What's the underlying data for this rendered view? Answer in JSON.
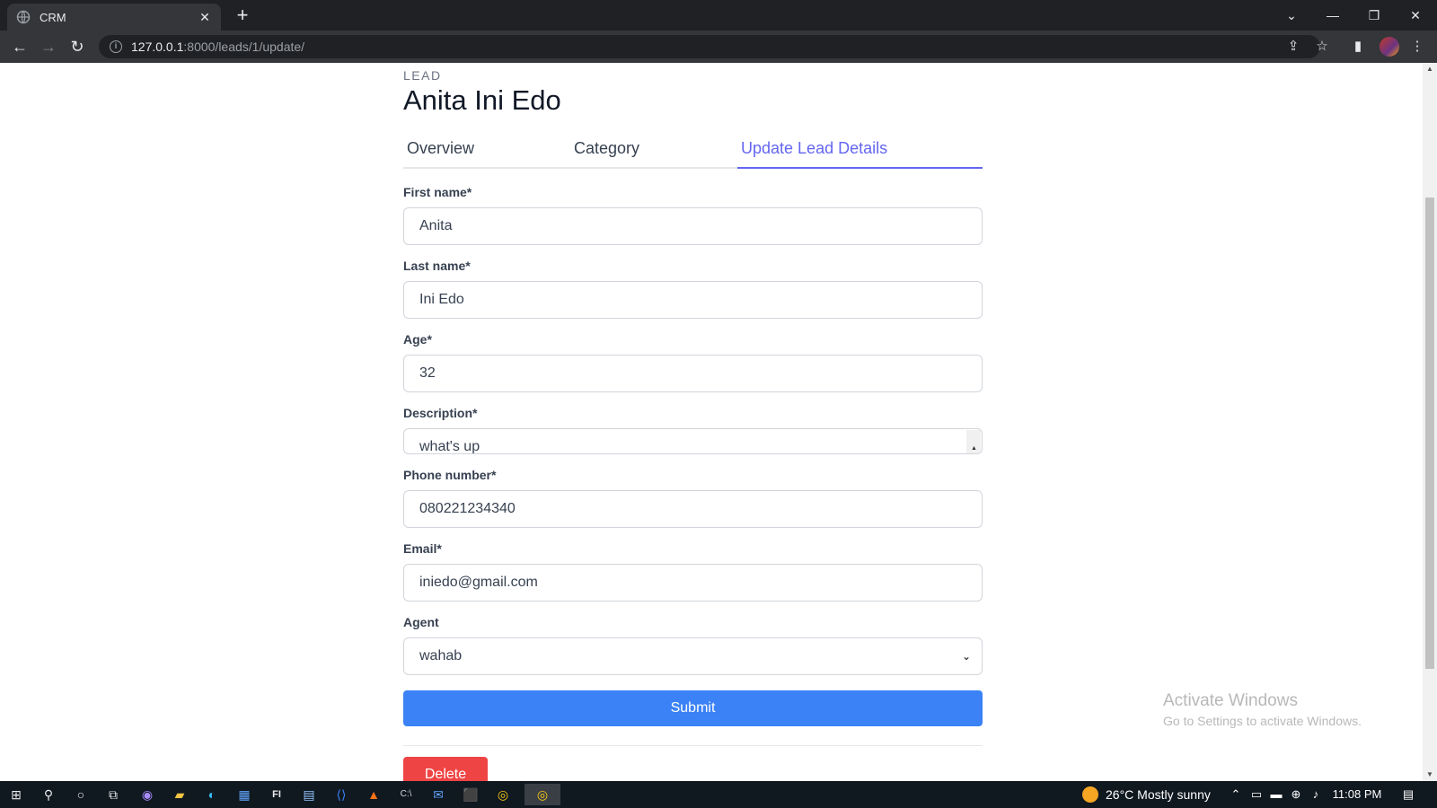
{
  "browser": {
    "tab_title": "CRM",
    "url_host": "127.0.0.1",
    "url_path": ":8000/leads/1/update/"
  },
  "page": {
    "eyebrow": "LEAD",
    "lead_name": "Anita Ini Edo",
    "tabs": [
      {
        "label": "Overview",
        "active": false
      },
      {
        "label": "Category",
        "active": false
      },
      {
        "label": "Update Lead Details",
        "active": true
      }
    ],
    "form": {
      "first_name": {
        "label": "First name*",
        "value": "Anita"
      },
      "last_name": {
        "label": "Last name*",
        "value": "Ini Edo"
      },
      "age": {
        "label": "Age*",
        "value": "32"
      },
      "description": {
        "label": "Description*",
        "value": "what's up"
      },
      "phone": {
        "label": "Phone number*",
        "value": "080221234340"
      },
      "email": {
        "label": "Email*",
        "value": "iniedo@gmail.com"
      },
      "agent": {
        "label": "Agent",
        "value": "wahab"
      },
      "submit_label": "Submit",
      "delete_label": "Delete"
    },
    "accent": "#6366f1",
    "submit_color": "#3b82f6",
    "delete_color": "#ef4444"
  },
  "watermark": {
    "title": "Activate Windows",
    "subtitle": "Go to Settings to activate Windows."
  },
  "taskbar": {
    "weather": "26°C  Mostly sunny",
    "time": "11:08 PM"
  }
}
